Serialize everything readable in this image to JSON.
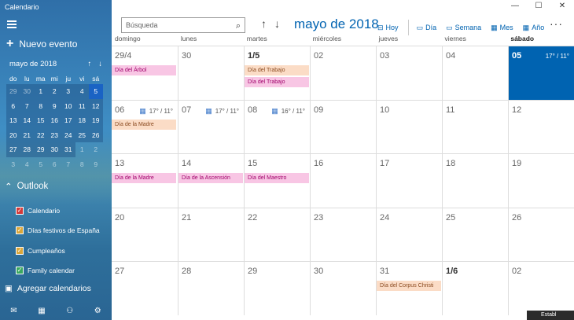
{
  "app": {
    "title": "Calendario"
  },
  "sidebar": {
    "new_event": "Nuevo evento",
    "mini_calendar": {
      "title": "mayo de 2018",
      "dow": [
        "do",
        "lu",
        "ma",
        "mi",
        "ju",
        "vi",
        "sá"
      ],
      "weeks": [
        [
          "29",
          "30",
          "1",
          "2",
          "3",
          "4",
          "5"
        ],
        [
          "6",
          "7",
          "8",
          "9",
          "10",
          "11",
          "12"
        ],
        [
          "13",
          "14",
          "15",
          "16",
          "17",
          "18",
          "19"
        ],
        [
          "20",
          "21",
          "22",
          "23",
          "24",
          "25",
          "26"
        ],
        [
          "27",
          "28",
          "29",
          "30",
          "31",
          "1",
          "2"
        ],
        [
          "3",
          "4",
          "5",
          "6",
          "7",
          "8",
          "9"
        ]
      ]
    },
    "outlook_label": "Outlook",
    "calendars": [
      {
        "label": "Calendario",
        "color": "#d33a3a"
      },
      {
        "label": "Días festivos de España",
        "color": "#d9a63a"
      },
      {
        "label": "Cumpleaños",
        "color": "#d9a63a"
      },
      {
        "label": "Family calendar",
        "color": "#3aa860"
      }
    ],
    "add_calendars": "Agregar calendarios"
  },
  "header": {
    "search_placeholder": "Búsqueda",
    "month_title": "mayo de 2018",
    "views": {
      "hoy": "Hoy",
      "dia": "Día",
      "semana": "Semana",
      "mes": "Mes",
      "ano": "Año"
    }
  },
  "weekdays": [
    "domingo",
    "lunes",
    "martes",
    "miércoles",
    "jueves",
    "viernes",
    "sábado"
  ],
  "weeks": [
    [
      {
        "num": "29/4",
        "events": [
          {
            "title": "Día del Árbol",
            "kind": "pink"
          }
        ]
      },
      {
        "num": "30"
      },
      {
        "num": "1/5",
        "bold": true,
        "events": [
          {
            "title": "Día del Trabajo",
            "kind": "peach"
          },
          {
            "title": "Día del Trabajo",
            "kind": "pink"
          }
        ]
      },
      {
        "num": "02"
      },
      {
        "num": "03"
      },
      {
        "num": "04"
      },
      {
        "num": "05",
        "today": true,
        "weather": "17° / 11°"
      }
    ],
    [
      {
        "num": "06",
        "weather": "17° / 11°",
        "events": [
          {
            "title": "Día de la Madre",
            "kind": "peach"
          }
        ]
      },
      {
        "num": "07",
        "weather": "17° / 11°"
      },
      {
        "num": "08",
        "weather": "16° / 11°"
      },
      {
        "num": "09"
      },
      {
        "num": "10"
      },
      {
        "num": "11"
      },
      {
        "num": "12"
      }
    ],
    [
      {
        "num": "13",
        "events": [
          {
            "title": "Día de la Madre",
            "kind": "pink"
          }
        ]
      },
      {
        "num": "14",
        "events": [
          {
            "title": "Día de la Ascensión",
            "kind": "pink"
          }
        ]
      },
      {
        "num": "15",
        "events": [
          {
            "title": "Día del Maestro",
            "kind": "pink"
          }
        ]
      },
      {
        "num": "16"
      },
      {
        "num": "17"
      },
      {
        "num": "18"
      },
      {
        "num": "19"
      }
    ],
    [
      {
        "num": "20"
      },
      {
        "num": "21"
      },
      {
        "num": "22"
      },
      {
        "num": "23"
      },
      {
        "num": "24"
      },
      {
        "num": "25"
      },
      {
        "num": "26"
      }
    ],
    [
      {
        "num": "27"
      },
      {
        "num": "28"
      },
      {
        "num": "29"
      },
      {
        "num": "30"
      },
      {
        "num": "31",
        "events": [
          {
            "title": "Día del Corpus Christi",
            "kind": "peach"
          }
        ]
      },
      {
        "num": "1/6",
        "bold": true
      },
      {
        "num": "02"
      }
    ]
  ],
  "status": "Establ"
}
